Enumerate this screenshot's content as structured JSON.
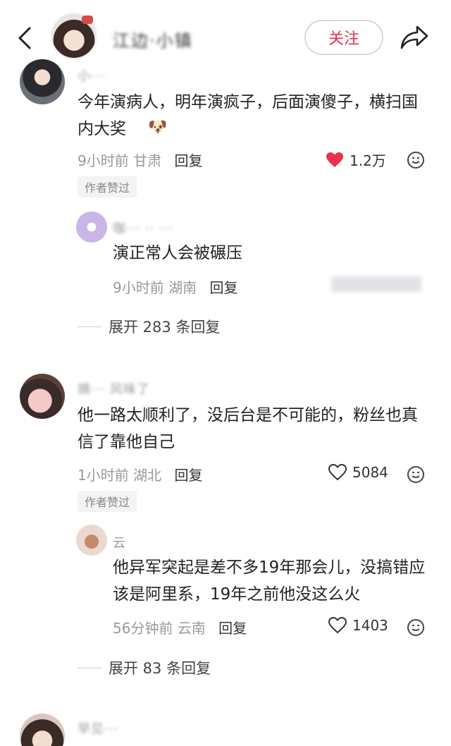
{
  "header": {
    "username": "江边·小镇",
    "follow_label": "关注"
  },
  "comments": [
    {
      "username": "小···",
      "text": "今年演病人，明年演疯子，后面演傻子，横扫国内大奖",
      "time": "9小时前",
      "location": "甘肃",
      "reply_label": "回复",
      "likes": "1.2万",
      "liked": true,
      "badge": "作者赞过",
      "replies": [
        {
          "username": "咖··· ·· ···",
          "text": "演正常人会被碾压",
          "time": "9小时前",
          "location": "湖南",
          "reply_label": "回复"
        }
      ],
      "expand_label": "展开 283 条回复"
    },
    {
      "username": "摘··· 风味了",
      "text": "他一路太顺利了，没后台是不可能的，粉丝也真信了靠他自己",
      "time": "1小时前",
      "location": "湖北",
      "reply_label": "回复",
      "likes": "5084",
      "liked": false,
      "badge": "作者赞过",
      "replies": [
        {
          "username": "云",
          "text": "他异军突起是差不多19年那会儿，没搞错应该是阿里系，19年之前他没这么火",
          "time": "56分钟前",
          "location": "云南",
          "reply_label": "回复",
          "likes": "1403"
        }
      ],
      "expand_label": "展开 83 条回复"
    },
    {
      "username": "早见···"
    }
  ],
  "colors": {
    "accent": "#e8334a",
    "meta": "#999999",
    "like_active": "#e8334a"
  }
}
